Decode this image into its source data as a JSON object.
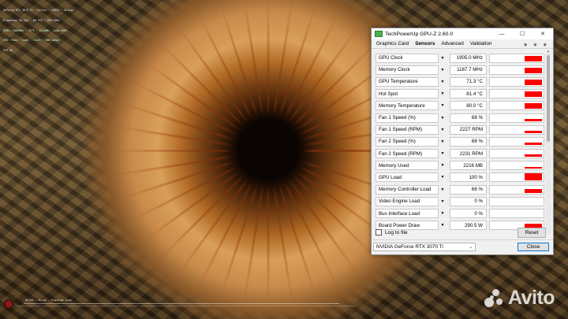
{
  "osd": {
    "lines": [
      "GeForce RTX 3070 Ti · Driver · D3D12 · Vulkan",
      "Frametime 16.7ms · 60 FPS · GPU 100%",
      "GPU1: 1905MHz · 71°C · 2216MB · Load 100%",
      "CPU: Temp · Load · Clock · RAM usage",
      "FPS 60"
    ],
    "graph_label": "60 FPS · 16.7ms · frametime graph"
  },
  "window": {
    "title": "TechPowerUp GPU-Z 2.60.0",
    "controls": {
      "minimize": "—",
      "maximize": "☐",
      "close": "✕"
    }
  },
  "tabs": [
    "Graphics Card",
    "Sensors",
    "Advanced",
    "Validation"
  ],
  "active_tab": "Sensors",
  "sensors": [
    {
      "label": "GPU Clock",
      "value": "1905.0 MHz",
      "level": 0.75
    },
    {
      "label": "Memory Clock",
      "value": "1187.7 MHz",
      "level": 0.75
    },
    {
      "label": "GPU Temperature",
      "value": "71.3 °C",
      "level": 0.75
    },
    {
      "label": "Hot Spot",
      "value": "81.4 °C",
      "level": 0.75
    },
    {
      "label": "Memory Temperature",
      "value": "80.0 °C",
      "level": 0.75
    },
    {
      "label": "Fan 1 Speed (%)",
      "value": "68 %",
      "level": 0.35
    },
    {
      "label": "Fan 1 Speed (RPM)",
      "value": "2227 RPM",
      "level": 0.35
    },
    {
      "label": "Fan 2 Speed (%)",
      "value": "68 %",
      "level": 0.35
    },
    {
      "label": "Fan 2 Speed (RPM)",
      "value": "2231 RPM",
      "level": 0.35
    },
    {
      "label": "Memory Used",
      "value": "2216 MB",
      "level": 0.2
    },
    {
      "label": "GPU Load",
      "value": "100 %",
      "level": 1.0
    },
    {
      "label": "Memory Controller Load",
      "value": "66 %",
      "level": 0.6
    },
    {
      "label": "Video Engine Load",
      "value": "0 %",
      "level": 0
    },
    {
      "label": "Bus Interface Load",
      "value": "0 %",
      "level": 0
    },
    {
      "label": "Board Power Draw",
      "value": "290.5 W",
      "level": 0.7
    }
  ],
  "log_to_file_label": "Log to file",
  "reset_label": "Reset",
  "gpu_selected": "NVIDIA GeForce RTX 3070 Ti",
  "close_label": "Close",
  "watermark": "Avito",
  "colors": {
    "sensor_bar": "#ff0000",
    "close_button_border": "#0078d4"
  },
  "icons": [
    "app-icon",
    "dropdown-arrow-icon",
    "camera-icon",
    "hamburger-menu-icon",
    "refresh-icon",
    "chevron-down-icon"
  ]
}
